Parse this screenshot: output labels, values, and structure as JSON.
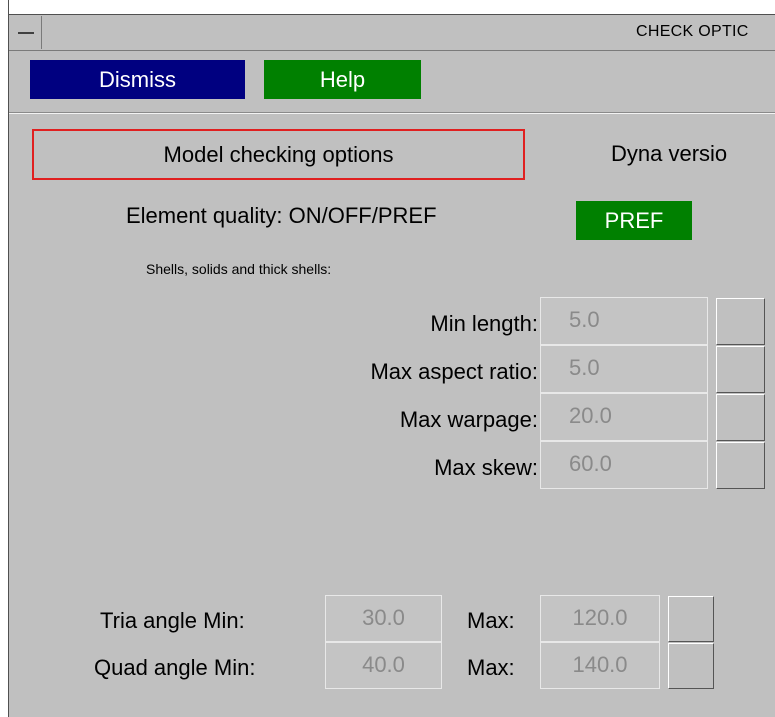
{
  "window": {
    "title": "CHECK OPTIC"
  },
  "toolbar": {
    "dismiss_label": "Dismiss",
    "help_label": "Help"
  },
  "section": {
    "label": "Model checking options",
    "dyna_label": "Dyna versio"
  },
  "element_quality": {
    "label": "Element quality: ON/OFF/PREF",
    "value": "PREF"
  },
  "shells": {
    "heading": "Shells, solids and thick shells:",
    "rows": [
      {
        "label": "Min length:",
        "value": "5.0"
      },
      {
        "label": "Max aspect ratio:",
        "value": "5.0"
      },
      {
        "label": "Max warpage:",
        "value": "20.0"
      },
      {
        "label": "Max skew:",
        "value": "60.0"
      }
    ]
  },
  "angles": [
    {
      "label": "Tria angle Min:",
      "min": "30.0",
      "max_label": "Max:",
      "max": "120.0"
    },
    {
      "label": "Quad angle Min:",
      "min": "40.0",
      "max_label": "Max:",
      "max": "140.0"
    }
  ],
  "colors": {
    "panel_bg": "#c0c0c0",
    "dismiss_bg": "#000080",
    "help_bg": "#008000",
    "pref_bg": "#008000",
    "section_border": "#e02020",
    "field_text": "#8a8a8a"
  }
}
